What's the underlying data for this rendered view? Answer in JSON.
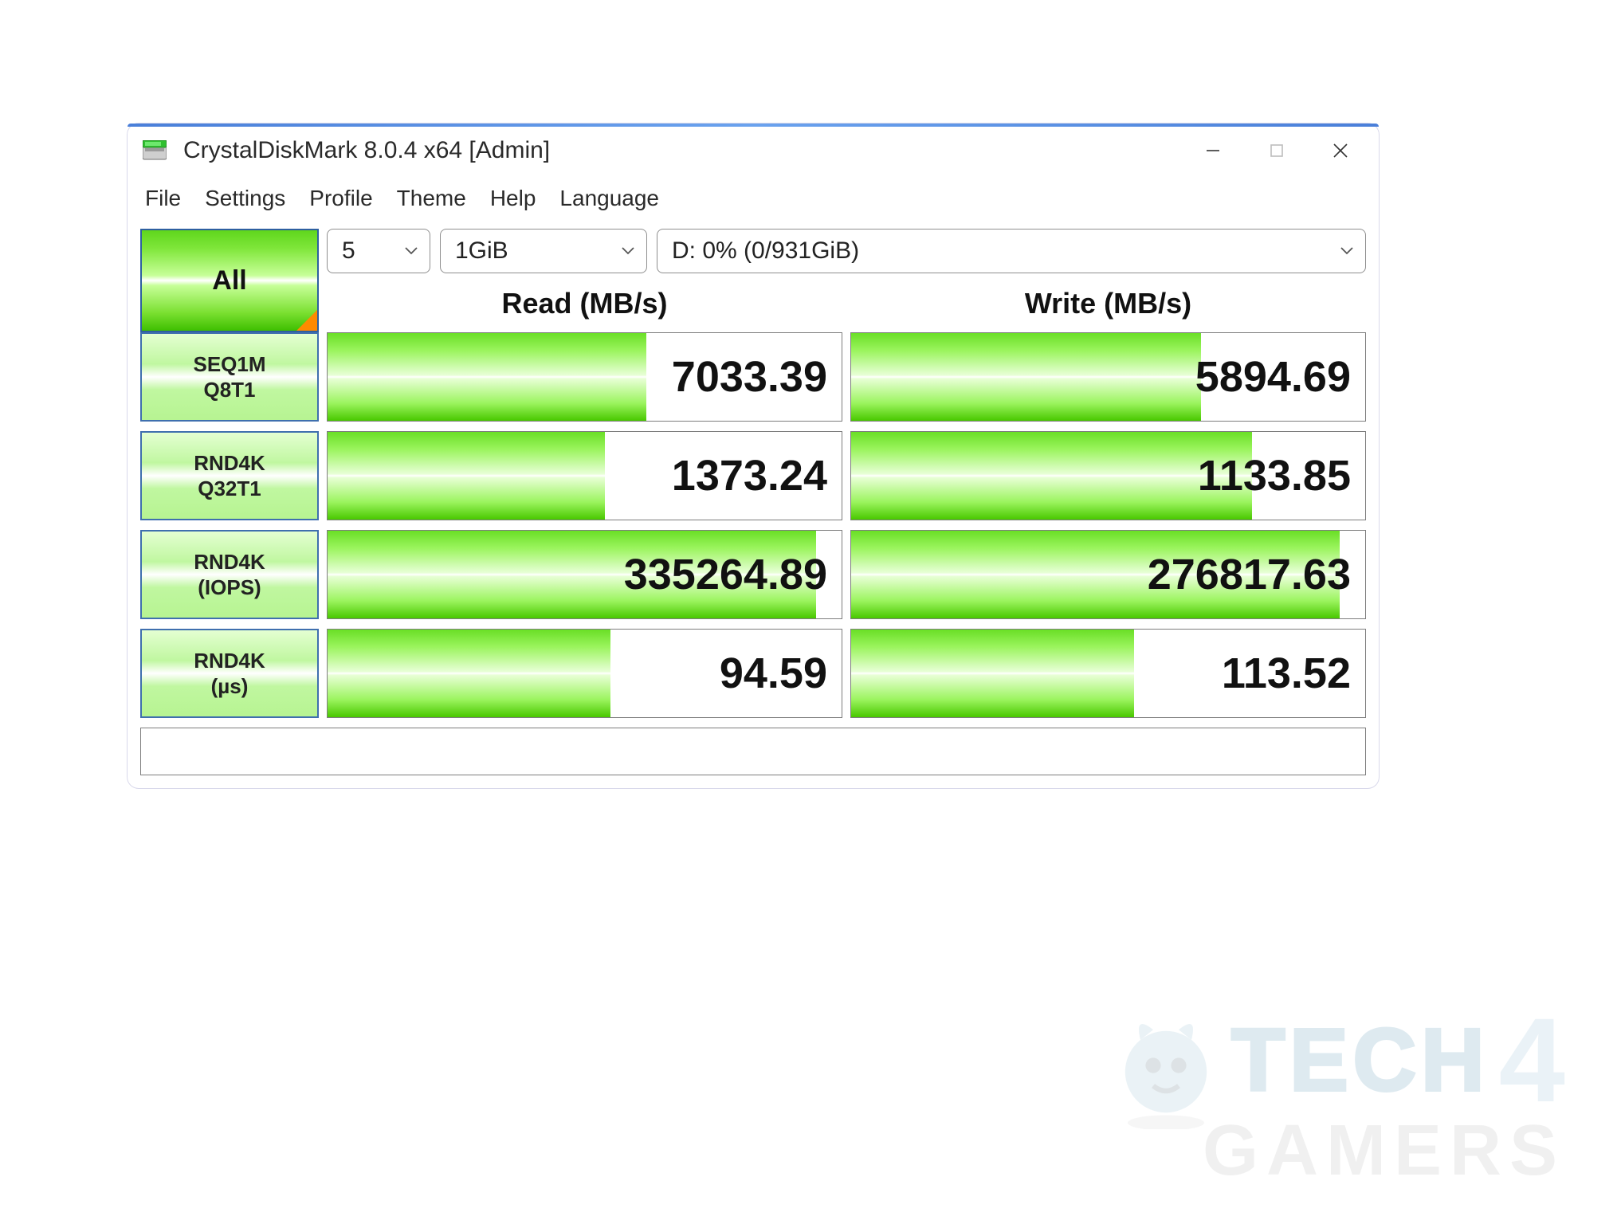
{
  "window": {
    "title": "CrystalDiskMark 8.0.4 x64 [Admin]"
  },
  "menu": {
    "file": "File",
    "settings": "Settings",
    "profile": "Profile",
    "theme": "Theme",
    "help": "Help",
    "language": "Language"
  },
  "controls": {
    "all_label": "All",
    "runs": "5",
    "size": "1GiB",
    "drive": "D: 0% (0/931GiB)"
  },
  "headers": {
    "read": "Read (MB/s)",
    "write": "Write (MB/s)"
  },
  "rows": [
    {
      "label_top": "SEQ1M",
      "label_bottom": "Q8T1",
      "read": "7033.39",
      "write": "5894.69",
      "read_fill": 62,
      "write_fill": 68
    },
    {
      "label_top": "RND4K",
      "label_bottom": "Q32T1",
      "read": "1373.24",
      "write": "1133.85",
      "read_fill": 54,
      "write_fill": 78
    },
    {
      "label_top": "RND4K",
      "label_bottom": "(IOPS)",
      "read": "335264.89",
      "write": "276817.63",
      "read_fill": 95,
      "write_fill": 95
    },
    {
      "label_top": "RND4K",
      "label_bottom": "(µs)",
      "read": "94.59",
      "write": "113.52",
      "read_fill": 55,
      "write_fill": 55
    }
  ],
  "watermark": {
    "tech": "TECH",
    "four": "4",
    "gamers": "GAMERS"
  }
}
